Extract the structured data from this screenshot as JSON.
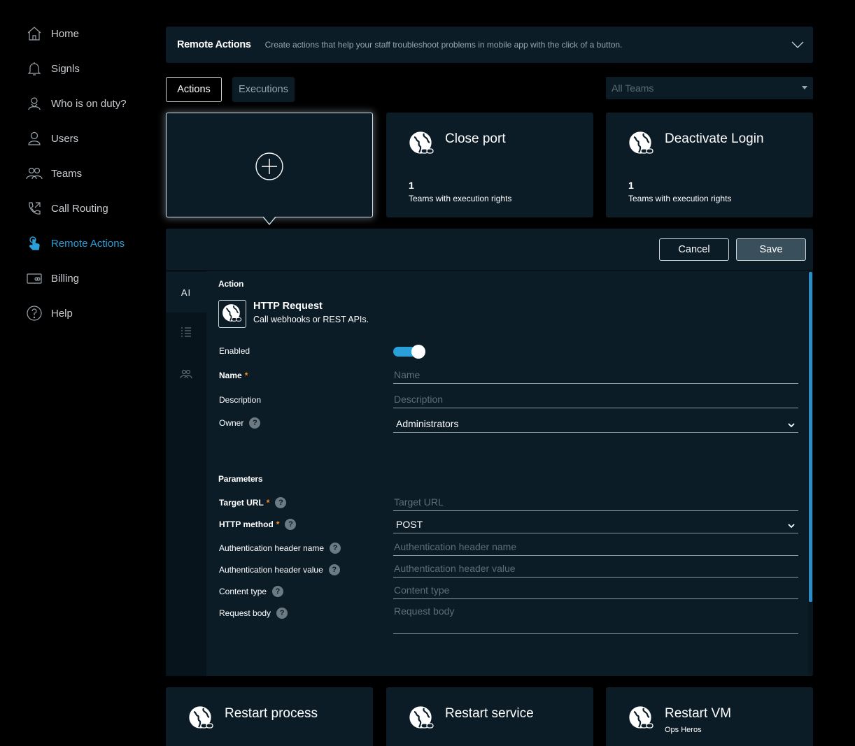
{
  "sidebar": {
    "items": [
      {
        "label": "Home",
        "icon": "home-icon"
      },
      {
        "label": "Signls",
        "icon": "bell-icon"
      },
      {
        "label": "Who is on duty?",
        "icon": "user-duty-icon"
      },
      {
        "label": "Users",
        "icon": "user-icon"
      },
      {
        "label": "Teams",
        "icon": "team-icon"
      },
      {
        "label": "Call Routing",
        "icon": "phone-icon"
      },
      {
        "label": "Remote Actions",
        "icon": "touch-icon",
        "active": true
      },
      {
        "label": "Billing",
        "icon": "billing-icon"
      },
      {
        "label": "Help",
        "icon": "help-icon"
      }
    ],
    "active_color": "#2a9fd8"
  },
  "header": {
    "title": "Remote Actions",
    "description": "Create actions that help your staff troubleshoot problems in mobile app with the click of a button."
  },
  "tabs": [
    {
      "label": "Actions",
      "selected": true
    },
    {
      "label": "Executions",
      "selected": false
    }
  ],
  "team_filter": {
    "placeholder": "All Teams"
  },
  "cards": [
    {
      "title": "Close port",
      "count": "1",
      "count_label": "Teams with execution rights"
    },
    {
      "title": "Deactivate Login",
      "count": "1",
      "count_label": "Teams with execution rights"
    }
  ],
  "bottom_cards": [
    {
      "title": "Restart process",
      "subtitle": ""
    },
    {
      "title": "Restart service",
      "subtitle": ""
    },
    {
      "title": "Restart VM",
      "subtitle": "Ops Heros"
    }
  ],
  "editor": {
    "cancel_label": "Cancel",
    "save_label": "Save",
    "side_tab_label": "AI",
    "action_section": "Action",
    "action_type": {
      "title": "HTTP Request",
      "description": "Call webhooks or REST APIs."
    },
    "enabled_label": "Enabled",
    "enabled": true,
    "fields": {
      "name": {
        "label": "Name",
        "placeholder": "Name",
        "required": true
      },
      "description": {
        "label": "Description",
        "placeholder": "Description"
      },
      "owner": {
        "label": "Owner",
        "value": "Administrators"
      }
    },
    "parameters_section": "Parameters",
    "parameters": {
      "target_url": {
        "label": "Target URL",
        "placeholder": "Target URL"
      },
      "http_method": {
        "label": "HTTP method",
        "value": "POST"
      },
      "auth_header_name": {
        "label": "Authentication header name",
        "placeholder": "Authentication header name"
      },
      "auth_header_value": {
        "label": "Authentication header value",
        "placeholder": "Authentication header value"
      },
      "content_type": {
        "label": "Content type",
        "placeholder": "Content type"
      },
      "request_body": {
        "label": "Request body",
        "placeholder": "Request body"
      }
    },
    "required_mark": "*",
    "help_mark": "?"
  },
  "colors": {
    "background": "#000000",
    "panel": "#0b1c27",
    "accent": "#2a9fd8",
    "required": "#ff8c1a"
  }
}
